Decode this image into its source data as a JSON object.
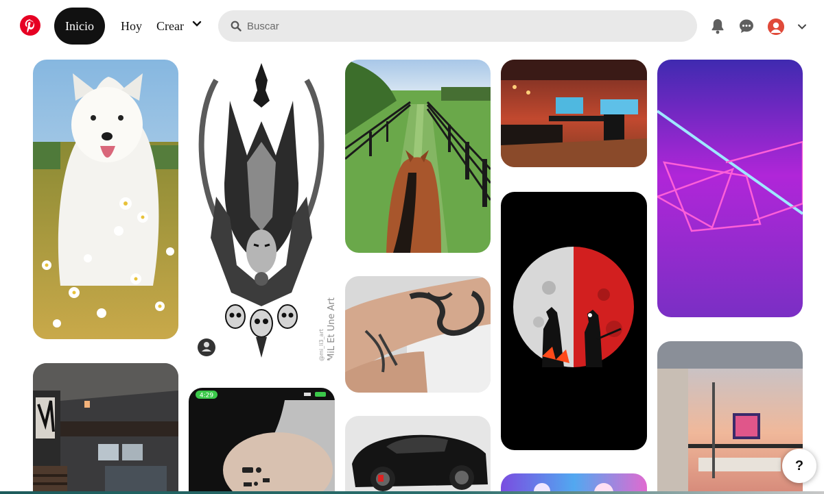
{
  "header": {
    "logo": "pinterest-logo",
    "nav": {
      "home": "Inicio",
      "today": "Hoy",
      "create": "Crear"
    },
    "search": {
      "placeholder": "Buscar",
      "value": ""
    },
    "icons": [
      "bell-icon",
      "chat-icon",
      "avatar",
      "chevron-down-icon"
    ]
  },
  "pins": [
    {
      "subject": "dog-in-flower-field"
    },
    {
      "subject": "anubis-tattoo-design",
      "signature": "MiL Et Une Art",
      "handle": "@mi_li3_art"
    },
    {
      "subject": "horse-ride-fence"
    },
    {
      "subject": "forearm-snake-tattoo"
    },
    {
      "subject": "gaming-room-red-lights"
    },
    {
      "subject": "anime-moon-silhouette"
    },
    {
      "subject": "neon-lines-pink-purple"
    },
    {
      "subject": "dark-loft-bedroom"
    },
    {
      "subject": "phone-screenshot-tattoo",
      "status_time": "4:29"
    },
    {
      "subject": "black-sports-car"
    },
    {
      "subject": "colorful-clouds"
    },
    {
      "subject": "sunset-apartment-interior"
    }
  ],
  "help": {
    "label": "?"
  },
  "colors": {
    "brand": "#e60023",
    "search_bg": "#e9e9e9",
    "home_pill": "#111111"
  }
}
